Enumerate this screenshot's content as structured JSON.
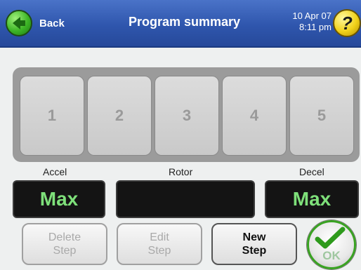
{
  "header": {
    "back_label": "Back",
    "title": "Program summary",
    "date": "10 Apr 07",
    "time": "8:11 pm",
    "help_symbol": "?"
  },
  "steps": [
    "1",
    "2",
    "3",
    "4",
    "5"
  ],
  "readouts": {
    "accel_label": "Accel",
    "accel_value": "Max",
    "rotor_label": "Rotor",
    "rotor_value": "",
    "decel_label": "Decel",
    "decel_value": "Max"
  },
  "actions": {
    "delete_line1": "Delete",
    "delete_line2": "Step",
    "edit_line1": "Edit",
    "edit_line2": "Step",
    "new_line1": "New",
    "new_line2": "Step",
    "ok_label": "OK"
  },
  "icons": {
    "back": "back-arrow-icon",
    "help": "help-icon",
    "ok": "checkmark-icon"
  },
  "colors": {
    "header": "#2f56ad",
    "readout_text": "#7ee07a",
    "ok_border": "#39a321"
  }
}
